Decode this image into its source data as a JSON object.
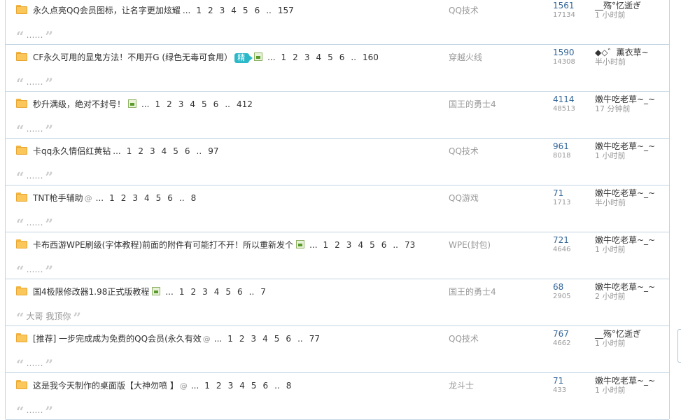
{
  "threads": [
    {
      "title": "永久点亮QQ会员图标，让名字更加炫耀",
      "icons": [],
      "pages": [
        "1",
        "2",
        "3",
        "4",
        "5",
        "6"
      ],
      "last_page": "157",
      "forum": "QQ技术",
      "replies": "1561",
      "views": "17134",
      "author": "__殇°忆逝ぎ",
      "time": "1 小时前",
      "quote": "……"
    },
    {
      "title": "CF永久可用的显鬼方法！不用开G (绿色无毒可食用）",
      "icons": [
        "badge",
        "image"
      ],
      "badge": "精",
      "pages": [
        "1",
        "2",
        "3",
        "4",
        "5",
        "6"
      ],
      "last_page": "160",
      "forum": "穿越火线",
      "replies": "1590",
      "views": "14308",
      "author": "◆◇゛薰衣草~",
      "time": "半小时前",
      "quote": "……"
    },
    {
      "title": "秒升满级，绝对不封号！",
      "icons": [
        "image"
      ],
      "pages": [
        "1",
        "2",
        "3",
        "4",
        "5",
        "6"
      ],
      "last_page": "412",
      "forum": "国王的勇士4",
      "replies": "4114",
      "views": "48513",
      "author": "嫩牛吃老草~_~",
      "time": "17 分钟前",
      "quote": "……"
    },
    {
      "title": "卡qq永久情侣红黄钻",
      "icons": [],
      "pages": [
        "1",
        "2",
        "3",
        "4",
        "5",
        "6"
      ],
      "last_page": "97",
      "forum": "QQ技术",
      "replies": "961",
      "views": "8018",
      "author": "嫩牛吃老草~_~",
      "time": "1 小时前",
      "quote": "……"
    },
    {
      "title": "TNT枪手辅助",
      "icons": [
        "clip"
      ],
      "pages": [
        "1",
        "2",
        "3",
        "4",
        "5",
        "6"
      ],
      "last_page": "8",
      "forum": "QQ游戏",
      "replies": "71",
      "views": "1713",
      "author": "嫩牛吃老草~_~",
      "time": "半小时前",
      "quote": "……"
    },
    {
      "title": "卡布西游WPE刷级(字体教程)前面的附件有可能打不开！所以重新发个",
      "icons": [
        "image"
      ],
      "pages": [
        "1",
        "2",
        "3",
        "4",
        "5",
        "6"
      ],
      "last_page": "73",
      "forum": "WPE(封包)",
      "replies": "721",
      "views": "4646",
      "author": "嫩牛吃老草~_~",
      "time": "1 小时前",
      "quote": "……"
    },
    {
      "title": "国4极限修改器1.98正式版教程",
      "icons": [
        "image"
      ],
      "pages": [
        "1",
        "2",
        "3",
        "4",
        "5",
        "6"
      ],
      "last_page": "7",
      "forum": "国王的勇士4",
      "replies": "68",
      "views": "2905",
      "author": "嫩牛吃老草~_~",
      "time": "2 小时前",
      "quote": "大哥 我顶你"
    },
    {
      "title": "[推荐] 一步完成成为免费的QQ会员(永久有效",
      "icons": [
        "clip"
      ],
      "pages": [
        "1",
        "2",
        "3",
        "4",
        "5",
        "6"
      ],
      "last_page": "77",
      "forum": "QQ技术",
      "replies": "767",
      "views": "4662",
      "author": "__殇°忆逝ぎ",
      "time": "1 小时前",
      "quote": "……"
    },
    {
      "title": "这是我今天制作的桌面版【大神勿喷 】",
      "icons": [
        "clip"
      ],
      "pages": [
        "1",
        "2",
        "3",
        "4",
        "5",
        "6"
      ],
      "last_page": "8",
      "forum": "龙斗士",
      "replies": "71",
      "views": "433",
      "author": "嫩牛吃老草~_~",
      "time": "1 小时前",
      "quote": "……"
    }
  ],
  "labels": {
    "ellipsis": "...",
    "page_sep": ".."
  }
}
